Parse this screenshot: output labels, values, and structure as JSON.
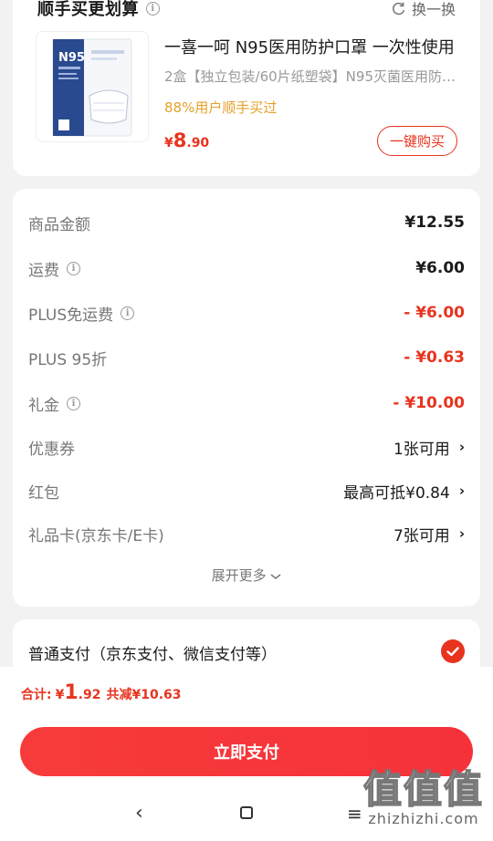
{
  "recommend": {
    "title": "顺手买更划算",
    "swap_label": "换一换",
    "product": {
      "image_label": "N95",
      "title": "一喜一呵 N95医用防护口罩 一次性使用",
      "subtitle": "2盒【独立包装/60片纸塑袋】N95灭菌医用防护口罩",
      "bought": "88%用户顺手买过",
      "price_currency": "¥",
      "price_int": "8",
      "price_dec": ".90",
      "buy_label": "一键购买"
    }
  },
  "fees": {
    "rows": [
      {
        "label": "商品金额",
        "value": "¥12.55"
      },
      {
        "label": "运费",
        "value": "¥6.00"
      },
      {
        "label": "PLUS免运费",
        "value": "- ¥6.00"
      },
      {
        "label": "PLUS 95折",
        "value": "- ¥0.63"
      },
      {
        "label": "礼金",
        "value": "- ¥10.00"
      },
      {
        "label": "优惠券",
        "value": "1张可用"
      },
      {
        "label": "红包",
        "value": "最高可抵¥0.84"
      },
      {
        "label": "礼品卡(京东卡/E卡)",
        "value": "7张可用"
      }
    ],
    "expand_label": "展开更多"
  },
  "payment": {
    "method_label": "普通支付（京东支付、微信支付等）"
  },
  "bottom": {
    "total_label": "合计:",
    "total_currency": "¥",
    "total_int": "1",
    "total_dec": ".92",
    "reduce_label": "共减¥10.63",
    "pay_button": "立即支付"
  },
  "watermark": {
    "big": "值值值",
    "small": "zhizhizhi.com"
  },
  "colors": {
    "accent": "#e8331f",
    "gold": "#e5a02a",
    "muted": "#777777"
  }
}
